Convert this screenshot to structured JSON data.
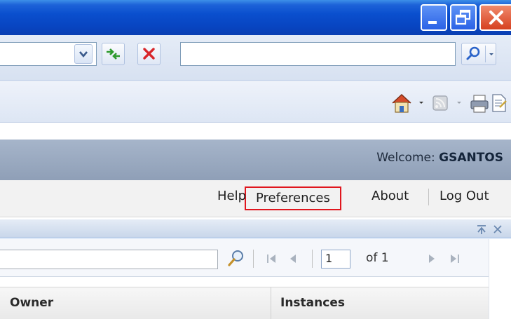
{
  "header": {
    "welcome_label": "Welcome:",
    "username": "GSANTOS"
  },
  "links": {
    "help": "Help",
    "preferences": "Preferences",
    "about": "About",
    "logout": "Log Out"
  },
  "pager": {
    "page": "1",
    "of_label": "of 1"
  },
  "grid": {
    "columns": [
      "Owner",
      "Instances"
    ]
  },
  "icons": {
    "window": [
      "minimize-icon",
      "restore-icon",
      "close-icon"
    ],
    "addressbar": [
      "chevron-down-icon",
      "refresh-icon",
      "stop-icon",
      "search-icon"
    ],
    "commandbar": [
      "home-icon",
      "feeds-icon",
      "print-icon",
      "page-icon"
    ],
    "panel": [
      "collapse-icon",
      "close-icon"
    ],
    "paging": [
      "search-icon",
      "first-page-icon",
      "prev-page-icon",
      "next-page-icon",
      "last-page-icon"
    ]
  },
  "colors": {
    "highlight": "#e0161e",
    "titlebar": "#0a4fce",
    "app_header": "#9aaac0"
  }
}
